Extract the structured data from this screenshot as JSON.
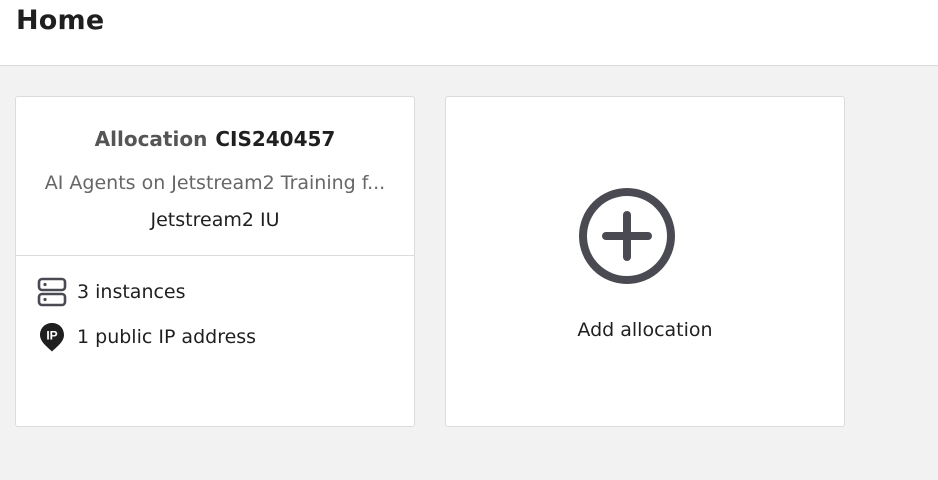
{
  "header": {
    "title": "Home"
  },
  "allocation": {
    "label": "Allocation",
    "id": "CIS240457",
    "description": "AI Agents on Jetstream2 Training f...",
    "site": "Jetstream2 IU",
    "resources": {
      "instances": "3 instances",
      "public_ip": "1 public IP address"
    },
    "icons": {
      "instances": "server-icon",
      "public_ip": "ip-location-pin-icon"
    }
  },
  "add_allocation": {
    "label": "Add allocation",
    "icon": "plus-circle-icon"
  },
  "colors": {
    "background": "#f2f2f2",
    "card": "#ffffff",
    "icon": "#4a4a52",
    "border": "#dcdcdc"
  }
}
